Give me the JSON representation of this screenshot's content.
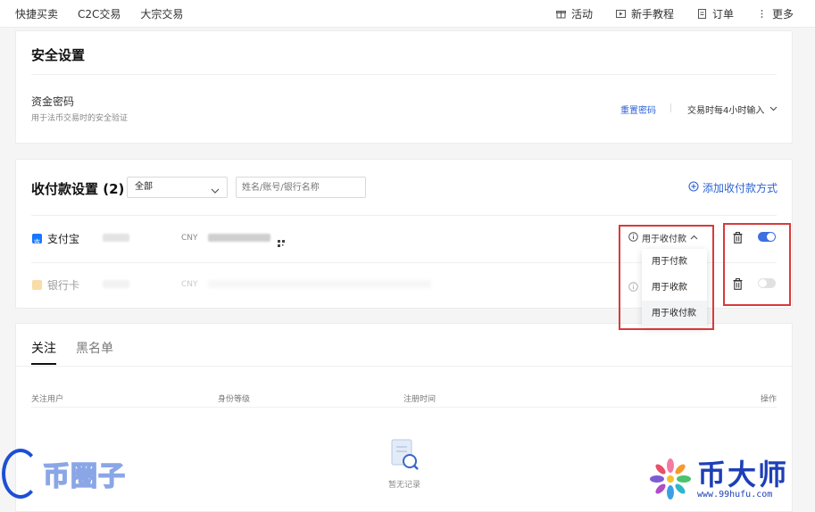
{
  "topnav": {
    "left": [
      "快捷买卖",
      "C2C交易",
      "大宗交易"
    ],
    "right": [
      {
        "label": "活动",
        "icon": "gift-icon"
      },
      {
        "label": "新手教程",
        "icon": "play-icon"
      },
      {
        "label": "订单",
        "icon": "document-icon"
      },
      {
        "label": "更多",
        "icon": "more-icon"
      }
    ]
  },
  "security": {
    "title": "安全设置",
    "fund_password_label": "资金密码",
    "fund_password_desc": "用于法币交易时的安全验证",
    "reset_link": "重置密码",
    "input_frequency": "交易时每4小时输入"
  },
  "payment": {
    "title": "收付款设置 (2)",
    "filter_value": "全部",
    "search_placeholder": "姓名/账号/银行名称",
    "add_method": "添加收付款方式",
    "rows": [
      {
        "name": "支付宝",
        "currency": "CNY",
        "usage": "用于收付款",
        "enabled": true
      },
      {
        "name": "银行卡",
        "currency": "CNY",
        "enabled": false
      }
    ],
    "usage_options": [
      "用于付款",
      "用于收款",
      "用于收付款"
    ],
    "selected_option": "用于收付款"
  },
  "follow": {
    "tabs": [
      "关注",
      "黑名单"
    ],
    "columns": [
      "关注用户",
      "身份等级",
      "注册时间",
      "操作"
    ],
    "empty_text": "暂无记录"
  },
  "watermarks": {
    "left": "币圈子",
    "right_title": "币大师",
    "right_url": "www.99hufu.com"
  },
  "colors": {
    "accent": "#2d63d6",
    "toggle_on": "#3f6fe0",
    "highlight_box": "#d83a3a"
  }
}
